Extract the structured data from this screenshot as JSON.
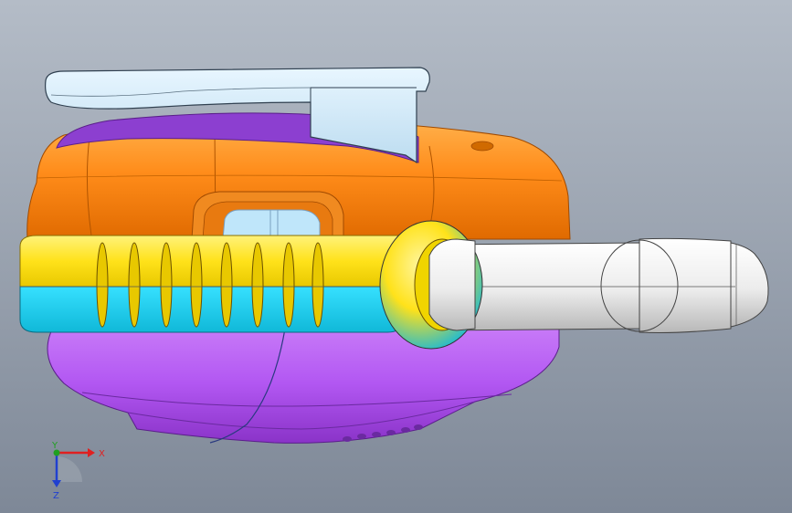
{
  "viewport": {
    "background_top": "#b4bcc7",
    "background_bottom": "#7e8897"
  },
  "model": {
    "colors": {
      "clip": "#cfe7f7",
      "top_shell": "#ff8c1a",
      "top_trim": "#8c3fd0",
      "band_yellow": "#ffe21a",
      "band_cyan": "#1ed2f0",
      "bottom_shell": "#b257f2",
      "antenna": "#ececec",
      "antenna_base": "#e8d000"
    }
  },
  "triad": {
    "x_label": "X",
    "y_label": "Y",
    "z_label": "Z",
    "x_color": "#e02020",
    "y_color": "#20a020",
    "z_color": "#2040d0"
  }
}
